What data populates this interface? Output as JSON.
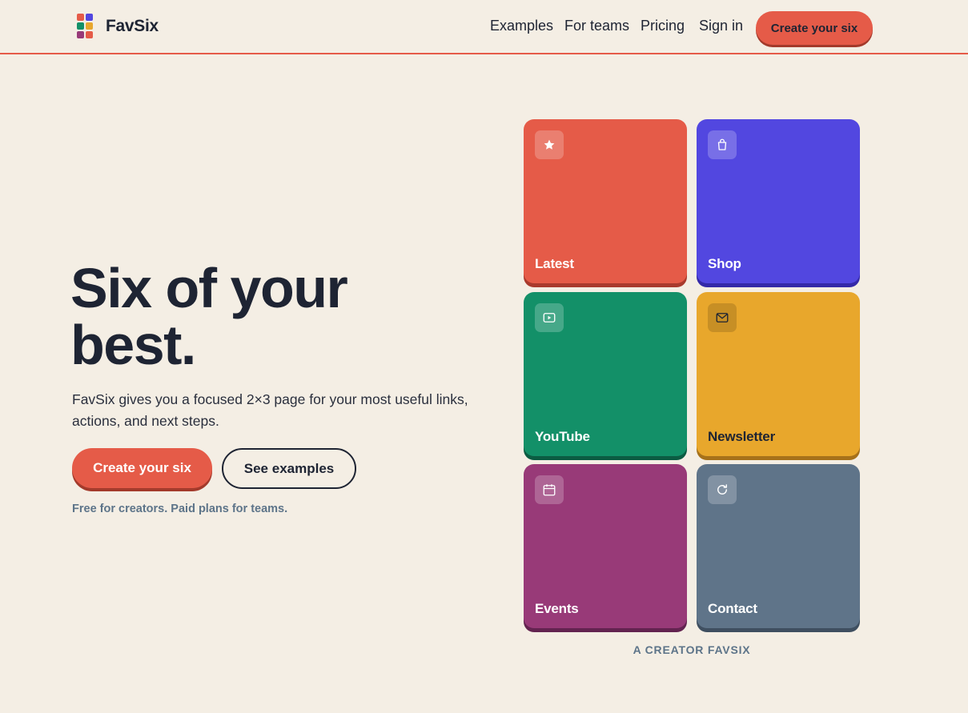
{
  "brand": {
    "name": "FavSix",
    "logo_colors": [
      "#e55b48",
      "#5247e0",
      "#139068",
      "#e8a72c",
      "#983a78",
      "#e55b48"
    ]
  },
  "nav": {
    "links": [
      "Examples",
      "For teams",
      "Pricing",
      "Sign in"
    ],
    "cta": "Create your six"
  },
  "hero": {
    "title_line1": "Six of your",
    "title_line2": "best.",
    "subtitle_line1": "FavSix gives you a focused 2×3 page for your most useful links,",
    "subtitle_line2": "actions, and next steps.",
    "primary_button": "Create your six",
    "secondary_button": "See examples",
    "note": "Free for creators. Paid plans for teams."
  },
  "tiles": [
    {
      "label": "Latest",
      "icon": "star-icon",
      "color": "#e55b48",
      "shadow": "#a93a2d",
      "text_color": "#ffffff"
    },
    {
      "label": "Shop",
      "icon": "shopping-bag-icon",
      "color": "#5247e0",
      "shadow": "#3429a8",
      "text_color": "#ffffff"
    },
    {
      "label": "YouTube",
      "icon": "play-icon",
      "color": "#139068",
      "shadow": "#0b5c42",
      "text_color": "#ffffff"
    },
    {
      "label": "Newsletter",
      "icon": "mail-icon",
      "color": "#e8a72c",
      "shadow": "#a6711a",
      "text_color": "#1e2433"
    },
    {
      "label": "Events",
      "icon": "calendar-icon",
      "color": "#983a78",
      "shadow": "#632350",
      "text_color": "#ffffff"
    },
    {
      "label": "Contact",
      "icon": "refresh-icon",
      "color": "#5f7489",
      "shadow": "#3f4f60",
      "text_color": "#ffffff"
    }
  ],
  "caption": "A CREATOR FAVSIX",
  "colors": {
    "background": "#f4eee4",
    "accent": "#e55b48",
    "text": "#1e2433",
    "muted": "#5d7489"
  }
}
